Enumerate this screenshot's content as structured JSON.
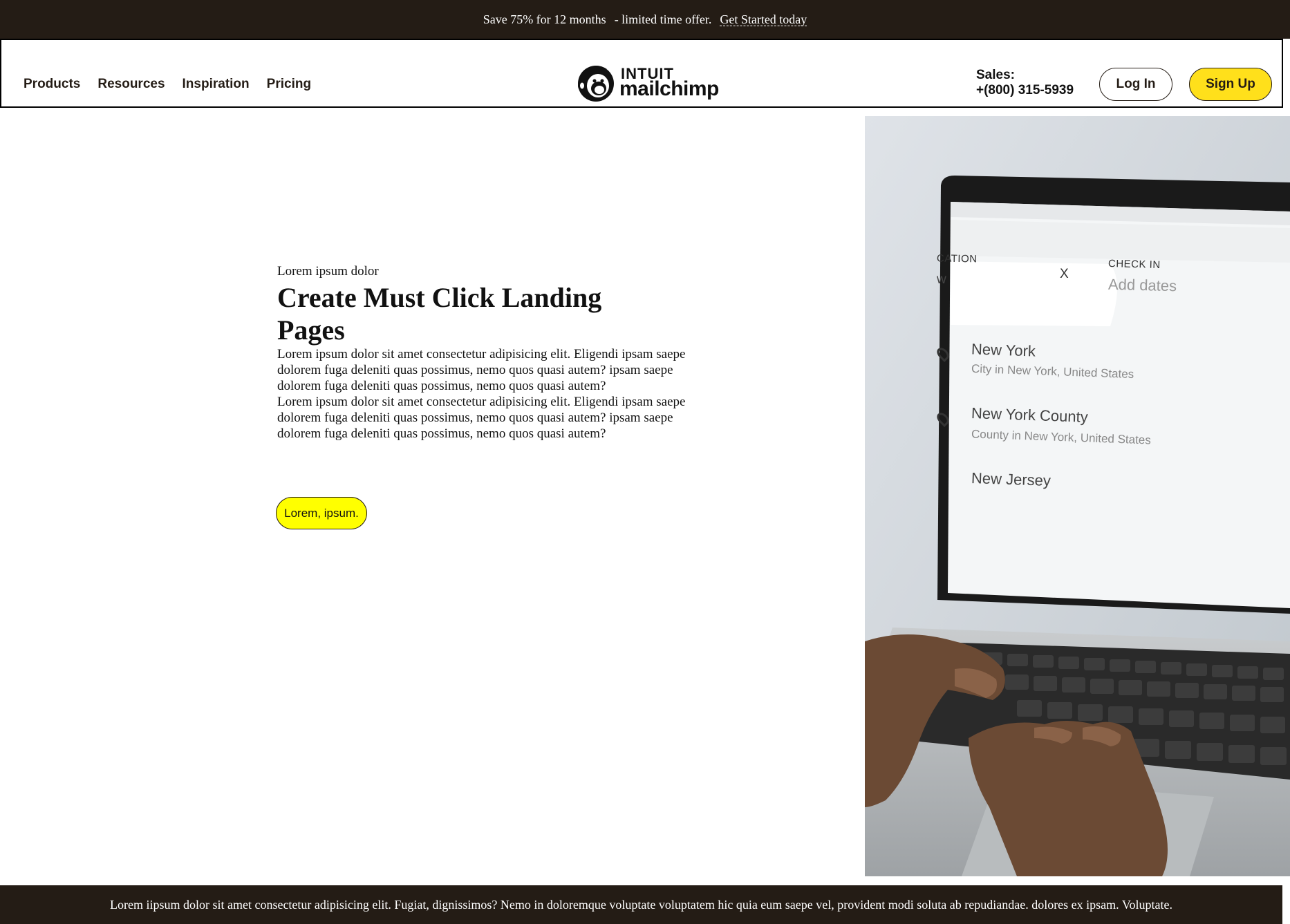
{
  "promo": {
    "offer": "Save 75% for 12 months",
    "detail": "- limited time offer.",
    "cta": "Get Started today"
  },
  "header": {
    "nav": [
      "Products",
      "Resources",
      "Inspiration",
      "Pricing"
    ],
    "logo": {
      "top": "INTUIT",
      "main": "mailchimp"
    },
    "sales_label": "Sales:",
    "sales_phone": "+(800) 315-5939",
    "login_label": "Log In",
    "signup_label": "Sign Up"
  },
  "hero": {
    "eyebrow": "Lorem ipsum dolor",
    "headline": "Create Must Click Landing Pages",
    "paragraph_1": "Lorem ipsum dolor sit amet consectetur adipisicing elit. Eligendi ipsam saepe dolorem fuga deleniti quas possimus, nemo quos quasi autem? ipsam saepe dolorem fuga deleniti quas possimus, nemo quos quasi autem?",
    "paragraph_2": "Lorem ipsum dolor sit amet consectetur adipisicing elit. Eligendi ipsam saepe dolorem fuga deleniti quas possimus, nemo quos quasi autem? ipsam saepe dolorem fuga deleniti quas possimus, nemo quos quasi autem?",
    "button_label": "Lorem, ipsum."
  },
  "photo": {
    "location_label": "CATION",
    "typed_text": "w",
    "clear": "X",
    "checkin_label": "CHECK IN",
    "checkin_placeholder": "Add dates",
    "results": [
      {
        "title": "New York",
        "subtitle": "City in New York, United States"
      },
      {
        "title": "New York County",
        "subtitle": "County in New York, United States"
      },
      {
        "title": "New Jersey",
        "subtitle": ""
      }
    ]
  },
  "footer": {
    "text": "Lorem iipsum dolor sit amet consectetur adipisicing elit. Fugiat, dignissimos? Nemo in doloremque voluptate voluptatem hic quia eum saepe vel, provident modi soluta ab repudiandae. dolores ex ipsam. Voluptate."
  },
  "colors": {
    "dark": "#241c15",
    "signup_yellow": "#ffe01b",
    "hero_button_yellow": "#ffff00"
  }
}
